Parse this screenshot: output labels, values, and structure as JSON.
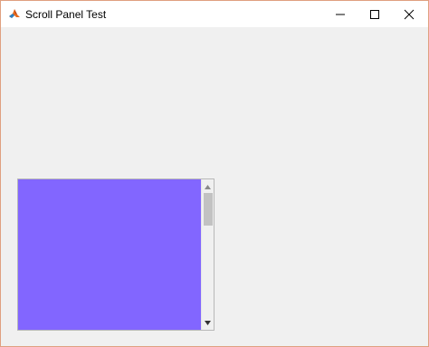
{
  "window": {
    "title": "Scroll Panel Test",
    "app_icon": "matlab-logo-icon",
    "controls": {
      "minimize_icon": "minimize-icon",
      "maximize_icon": "maximize-icon",
      "close_icon": "close-icon"
    }
  },
  "scroll_panel": {
    "content_color": "#8266ff",
    "scrollbar": {
      "orientation": "vertical",
      "up_icon": "arrow-up-icon",
      "down_icon": "arrow-down-icon",
      "position_fraction": 0.0
    }
  }
}
